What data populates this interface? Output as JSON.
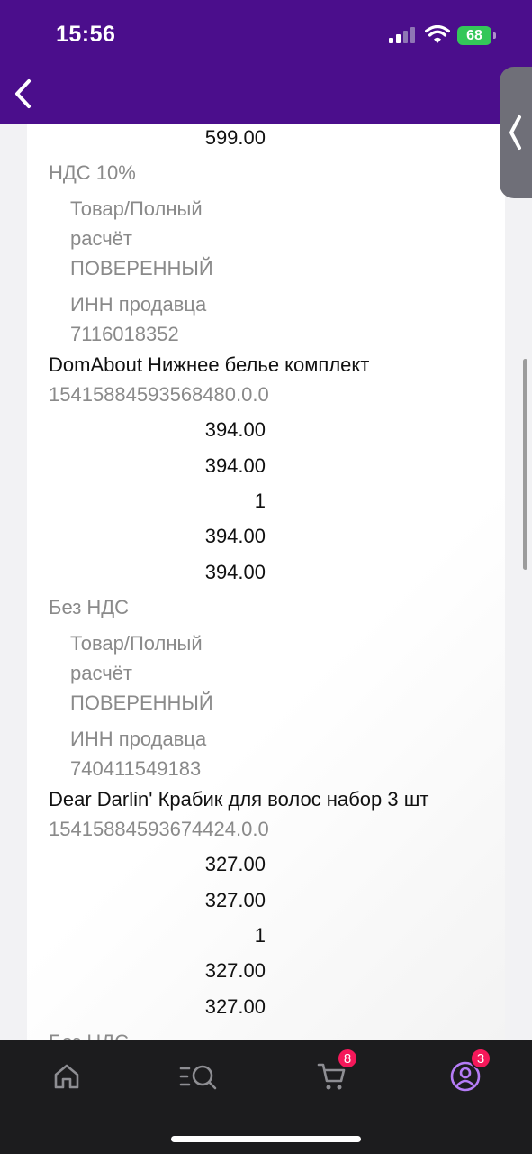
{
  "status_bar": {
    "time": "15:56",
    "battery": "68"
  },
  "receipt": {
    "top_amount": "599.00",
    "vat_1": "НДС 10%",
    "item1_type_line1": "Товар/Полный",
    "item1_type_line2": "расчёт",
    "item1_agent": "ПОВЕРЕННЫЙ",
    "item1_inn_label": "ИНН продавца",
    "item1_inn": "7116018352",
    "item2_name": "DomAbout Нижнее белье комплект",
    "item2_code": "15415884593568480.0.0",
    "item2_amounts": [
      "394.00",
      "394.00",
      "1",
      "394.00",
      "394.00"
    ],
    "vat_2": "Без НДС",
    "item2_type_line1": "Товар/Полный",
    "item2_type_line2": "расчёт",
    "item2_agent": "ПОВЕРЕННЫЙ",
    "item2_inn_label": "ИНН продавца",
    "item2_inn": "740411549183",
    "item3_name": "Dear Darlin' Крабик для волос набор 3 шт",
    "item3_code": "15415884593674424.0.0",
    "item3_amounts": [
      "327.00",
      "327.00",
      "1",
      "327.00",
      "327.00"
    ],
    "vat_3": "Без НДС"
  },
  "bottom_nav": {
    "items": [
      "home",
      "catalog-search",
      "cart",
      "profile"
    ],
    "cart_badge": "8",
    "profile_badge": "3",
    "active": "profile",
    "active_color": "#b57cf6"
  }
}
